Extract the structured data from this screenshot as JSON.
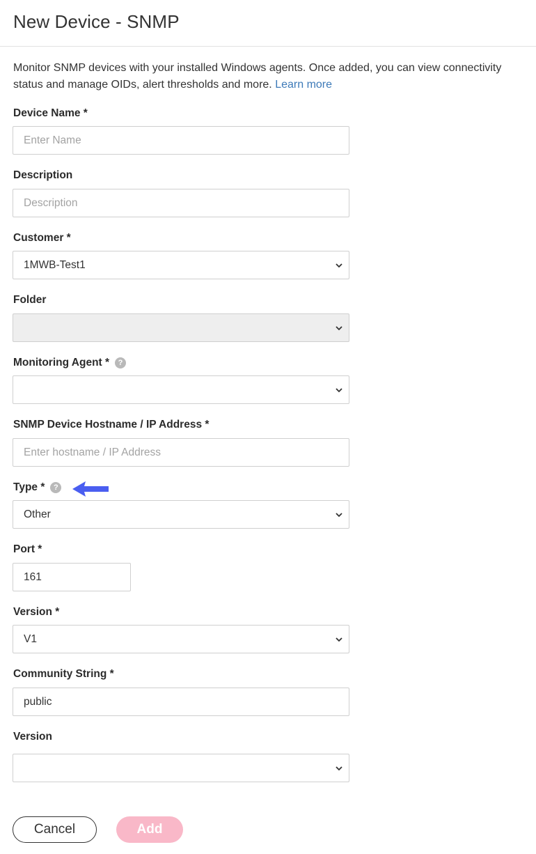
{
  "header": {
    "title": "New Device - SNMP"
  },
  "intro": {
    "text": "Monitor SNMP devices with your installed Windows agents. Once added, you can view connectivity status and manage OIDs, alert thresholds and more.",
    "link": "Learn more"
  },
  "form": {
    "device_name": {
      "label": "Device Name *",
      "placeholder": "Enter Name",
      "value": ""
    },
    "description": {
      "label": "Description",
      "placeholder": "Description",
      "value": ""
    },
    "customer": {
      "label": "Customer *",
      "value": "1MWB-Test1"
    },
    "folder": {
      "label": "Folder",
      "value": "",
      "disabled": true
    },
    "monitoring_agent": {
      "label": "Monitoring Agent *",
      "value": ""
    },
    "hostname": {
      "label": "SNMP Device Hostname / IP Address *",
      "placeholder": "Enter hostname / IP Address",
      "value": ""
    },
    "type": {
      "label": "Type *",
      "value": "Other"
    },
    "port": {
      "label": "Port *",
      "value": "161"
    },
    "version": {
      "label": "Version *",
      "value": "V1"
    },
    "community_string": {
      "label": "Community String *",
      "value": "public"
    },
    "version2": {
      "label": "Version",
      "value": ""
    }
  },
  "buttons": {
    "cancel": "Cancel",
    "add": "Add"
  },
  "icons": {
    "help": "help-icon",
    "chevron": "chevron-down-icon",
    "annotation": "annotation-arrow-icon"
  },
  "help_glyph": "?",
  "colors": {
    "link": "#3d7ab8",
    "add_button": "#f9b8c8",
    "annotation_arrow": "#4a5ef0",
    "disabled_field": "#eeeeee"
  }
}
